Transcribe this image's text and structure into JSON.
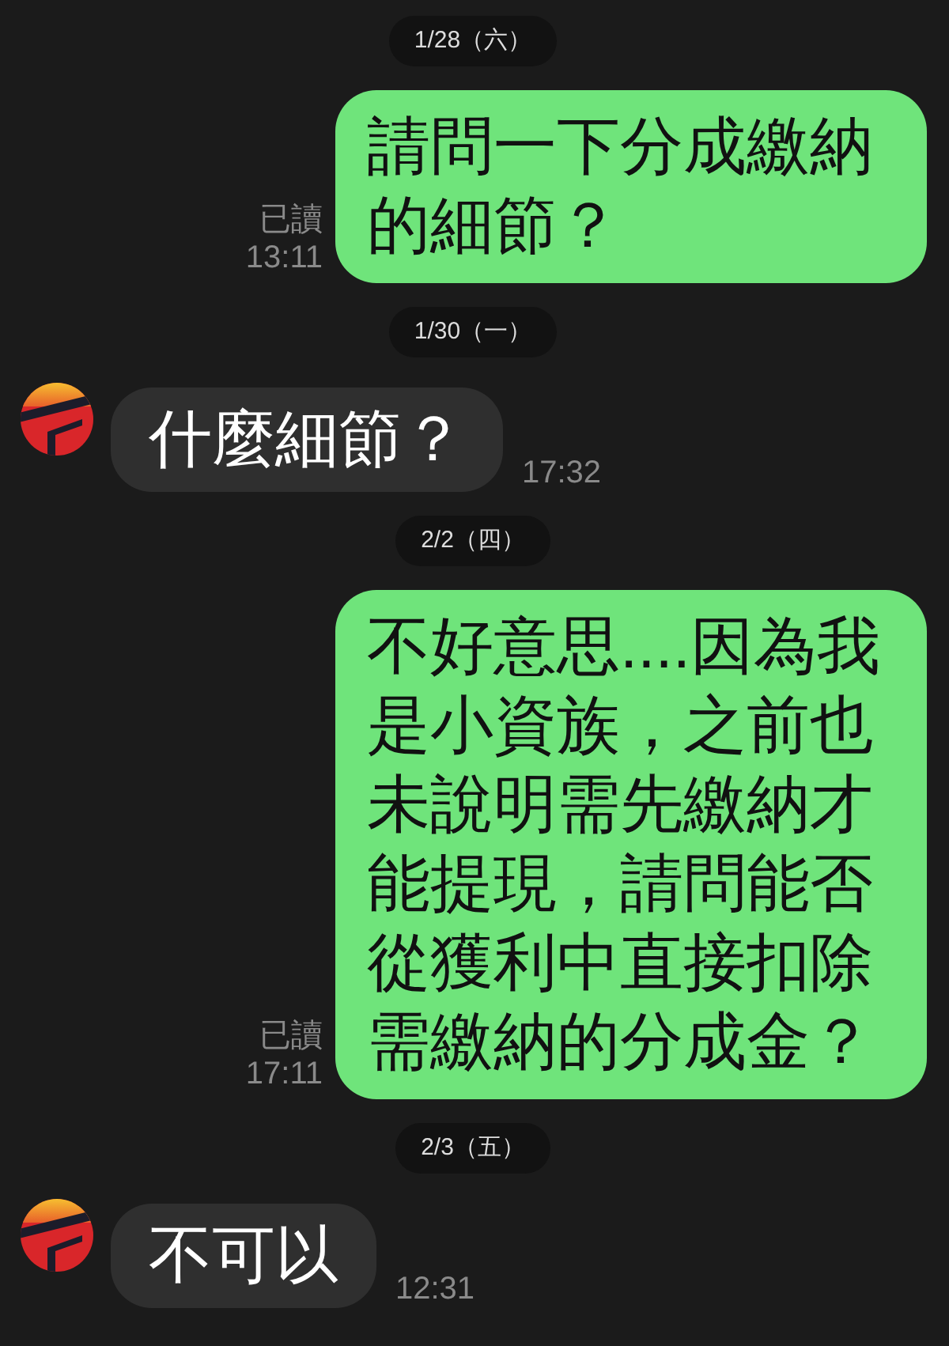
{
  "messages": [
    {
      "kind": "date",
      "text": "1/28（六）"
    },
    {
      "kind": "outgoing",
      "text": "請問一下分成繳納的細節？",
      "read": "已讀",
      "time": "13:11"
    },
    {
      "kind": "date",
      "text": "1/30（一）"
    },
    {
      "kind": "incoming",
      "text": "什麼細節？",
      "time": "17:32"
    },
    {
      "kind": "date",
      "text": "2/2（四）"
    },
    {
      "kind": "outgoing",
      "text": "不好意思....因為我是小資族，之前也未說明需先繳納才能提現，請問能否從獲利中直接扣除需繳納的分成金？",
      "read": "已讀",
      "time": "17:11"
    },
    {
      "kind": "date",
      "text": "2/3（五）"
    },
    {
      "kind": "incoming",
      "text": "不可以",
      "time": "12:31"
    }
  ]
}
